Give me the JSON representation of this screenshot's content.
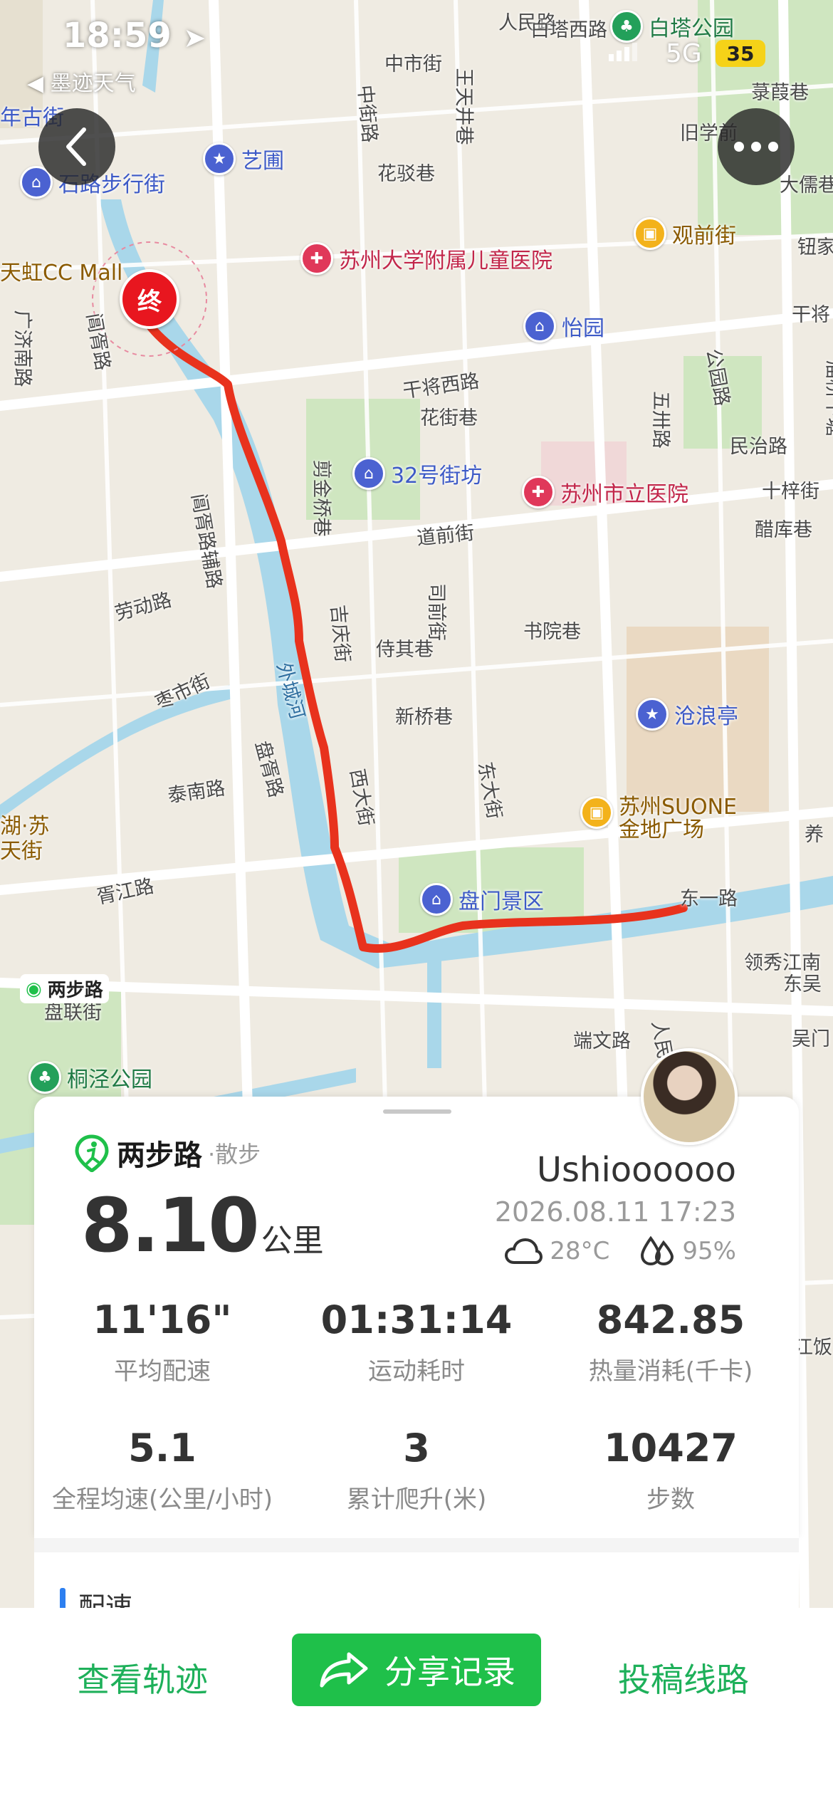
{
  "status_bar": {
    "time": "18:59",
    "back_app": "◀ 墨迹天气",
    "network": "5G",
    "battery": "35"
  },
  "map": {
    "labels": [
      "人民路",
      "白塔西路",
      "中市街",
      "王天井巷",
      "花驳巷",
      "中街路",
      "旧学前",
      "菉葭巷",
      "大儒巷",
      "钮家",
      "干将",
      "庙桥下塘",
      "阊胥路",
      "广济南路",
      "干将西路",
      "花街巷",
      "五卅路",
      "公园路",
      "民治路",
      "十梓街",
      "醋库巷",
      "剪金桥巷",
      "道前街",
      "司前街",
      "阊胥路辅路",
      "劳动路",
      "吉庆街",
      "侍其巷",
      "书院巷",
      "枣市街",
      "外城河",
      "新桥巷",
      "盘胥路",
      "泰南路",
      "西大街",
      "东大街",
      "胥江路",
      "东一路",
      "领秀江南",
      "盘联街",
      "端文路",
      "人民",
      "东吴",
      "吴门",
      "养",
      "江饭",
      "石路步行街",
      "年古街",
      "天虹CC Mall",
      "湖·苏",
      "天街",
      "江南"
    ],
    "pois": [
      {
        "name": "白塔公园",
        "type": "green"
      },
      {
        "name": "艺圃",
        "type": "blue"
      },
      {
        "name": "石路步行街",
        "type": "blue"
      },
      {
        "name": "苏州大学附属儿童医院",
        "type": "red"
      },
      {
        "name": "观前街",
        "type": "orange"
      },
      {
        "name": "怡园",
        "type": "blue"
      },
      {
        "name": "32号街坊",
        "type": "blue"
      },
      {
        "name": "苏州市立医院",
        "type": "red"
      },
      {
        "name": "沧浪亭",
        "type": "blue"
      },
      {
        "name": "苏州SUONE\n金地广场",
        "type": "orange"
      },
      {
        "name": "盘门景区",
        "type": "blue"
      },
      {
        "name": "桐泾公园",
        "type": "green"
      },
      {
        "name": "两步路",
        "type": "brand"
      }
    ],
    "end_marker": "终",
    "route_color": "#e8321d"
  },
  "card": {
    "brand": "两步路",
    "activity": "·散步",
    "username": "Ushioooooo",
    "datetime": "2026.08.11 17:23",
    "temperature": "28°C",
    "humidity": "95%",
    "distance": "8.10",
    "distance_unit": "公里",
    "stats": [
      {
        "value": "11'16\"",
        "label": "平均配速"
      },
      {
        "value": "01:31:14",
        "label": "运动耗时"
      },
      {
        "value": "842.85",
        "label": "热量消耗(千卡)"
      },
      {
        "value": "5.1",
        "label": "全程均速(公里/小时)"
      },
      {
        "value": "3",
        "label": "累计爬升(米)"
      },
      {
        "value": "10427",
        "label": "步数"
      }
    ],
    "section_title": "配速"
  },
  "actions": {
    "view_track": "查看轨迹",
    "share": "分享记录",
    "submit_route": "投稿线路"
  },
  "colors": {
    "accent_green": "#1fc04a",
    "route_red": "#e8321d"
  }
}
